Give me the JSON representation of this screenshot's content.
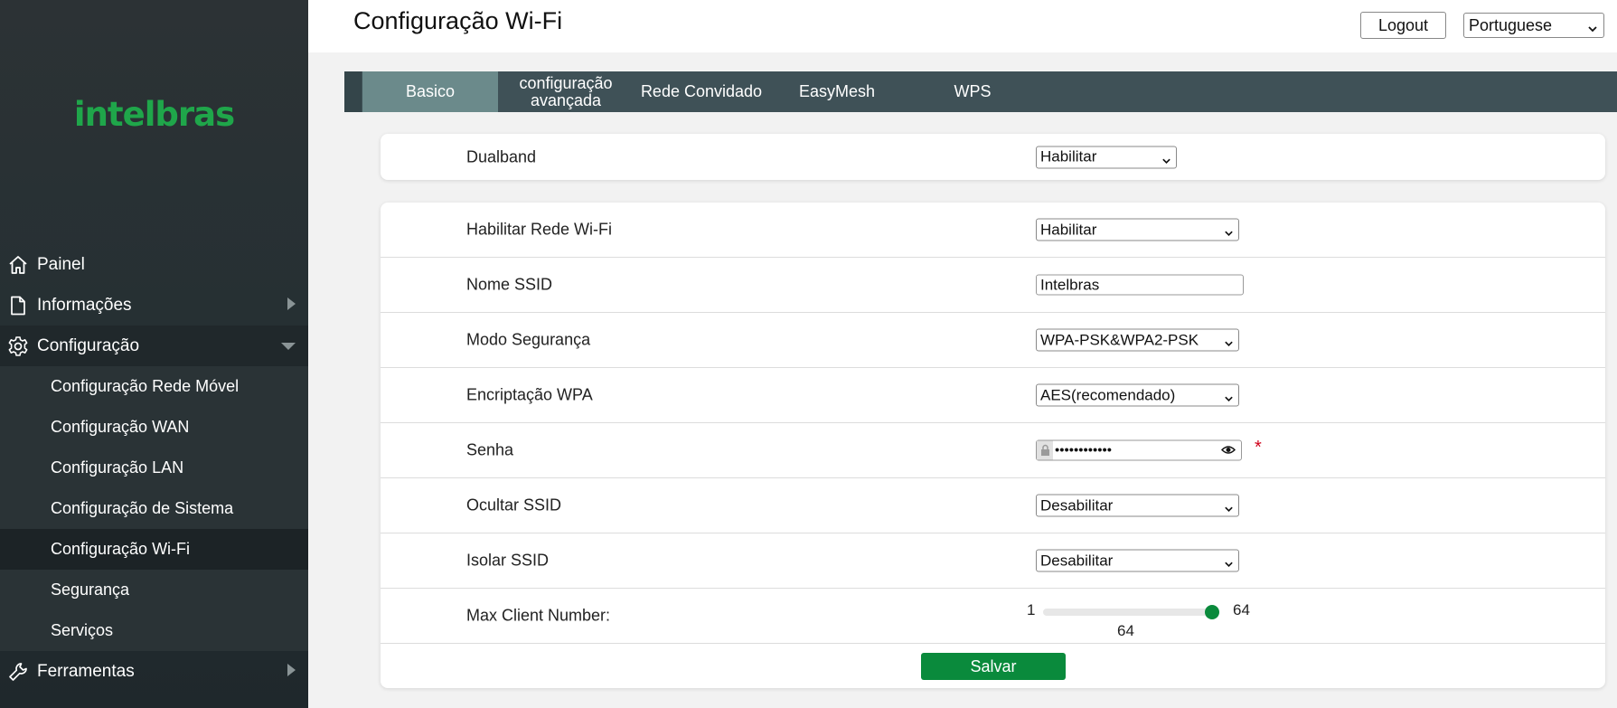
{
  "brand": {
    "logo_text": "intelbras",
    "accent": "#1fa64a",
    "primary_button": "#0a8a3c"
  },
  "header": {
    "title": "Configuração Wi-Fi",
    "logout_label": "Logout",
    "language": "Portuguese"
  },
  "sidebar": {
    "items": [
      {
        "label": "Painel",
        "icon": "home-icon"
      },
      {
        "label": "Informações",
        "icon": "document-icon",
        "arrow": "chevron-right-icon"
      },
      {
        "label": "Configuração",
        "icon": "gear-icon",
        "arrow": "chevron-down-icon"
      },
      {
        "label": "Ferramentas",
        "icon": "wrench-icon",
        "arrow": "chevron-right-icon"
      }
    ],
    "sub_items": [
      "Configuração Rede Móvel",
      "Configuração WAN",
      "Configuração LAN",
      "Configuração de Sistema",
      "Configuração Wi-Fi",
      "Segurança",
      "Serviços"
    ],
    "active_sub_item": "Configuração Wi-Fi"
  },
  "tabs": [
    {
      "label": "Basico",
      "active": true
    },
    {
      "label": "configuração avançada",
      "active": false
    },
    {
      "label": "Rede Convidado",
      "active": false
    },
    {
      "label": "EasyMesh",
      "active": false
    },
    {
      "label": "WPS",
      "active": false
    }
  ],
  "dualband": {
    "label": "Dualband",
    "value": "Habilitar"
  },
  "form": {
    "enable_wifi": {
      "label": "Habilitar Rede Wi-Fi",
      "value": "Habilitar"
    },
    "ssid_name": {
      "label": "Nome SSID",
      "value": "Intelbras"
    },
    "security_mode": {
      "label": "Modo Segurança",
      "value": "WPA-PSK&WPA2-PSK"
    },
    "wpa_encryption": {
      "label": "Encriptação WPA",
      "value": "AES(recomendado)"
    },
    "password": {
      "label": "Senha",
      "masked_value": "••••••••••••",
      "required_mark": "*"
    },
    "hide_ssid": {
      "label": "Ocultar SSID",
      "value": "Desabilitar"
    },
    "isolate_ssid": {
      "label": "Isolar SSID",
      "value": "Desabilitar"
    },
    "max_clients": {
      "label": "Max Client Number:",
      "min": "1",
      "max": "64",
      "value": "64",
      "fraction": 1.0
    },
    "save_label": "Salvar"
  }
}
